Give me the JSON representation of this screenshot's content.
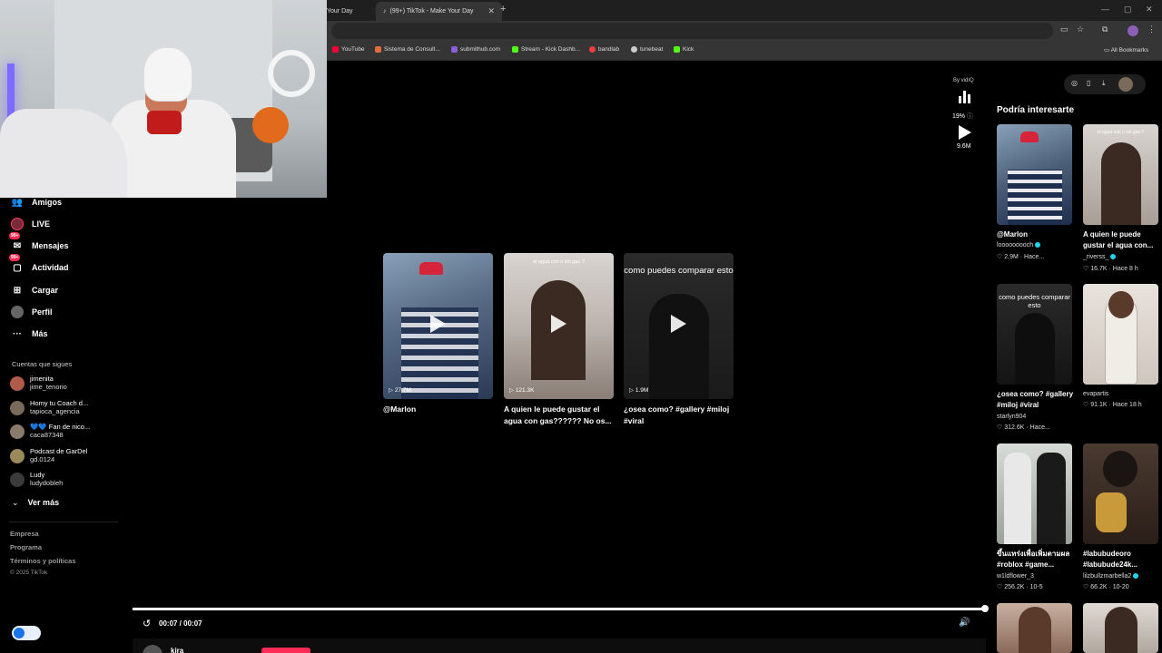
{
  "browser": {
    "tabs": [
      {
        "title": "Your Day"
      },
      {
        "title": "(99+) TikTok - Make Your Day"
      }
    ],
    "bookmarks": [
      "YouTube",
      "Sistema de Consult...",
      "submithub.com",
      "Stream - Kick Dashb...",
      "bandlab",
      "tunebeat",
      "Kick"
    ],
    "all_bookmarks": "All Bookmarks"
  },
  "sidebar": {
    "items": [
      {
        "label": "Amigos",
        "icon": "friends-icon"
      },
      {
        "label": "LIVE",
        "icon": "live-icon"
      },
      {
        "label": "Mensajes",
        "icon": "messages-icon",
        "badge": "99+"
      },
      {
        "label": "Actividad",
        "icon": "activity-icon",
        "badge": "99+"
      },
      {
        "label": "Cargar",
        "icon": "upload-icon"
      },
      {
        "label": "Perfil",
        "icon": "profile-icon"
      },
      {
        "label": "Más",
        "icon": "more-icon"
      }
    ],
    "following_title": "Cuentas que sigues",
    "following": [
      {
        "name": "jimenita",
        "handle": "jime_tenorio"
      },
      {
        "name": "Homy tu Coach d...",
        "handle": "tapioca_agencia"
      },
      {
        "name": "💙💙 Fan de nico...",
        "handle": "caca87348"
      },
      {
        "name": "Podcast de GarDel",
        "handle": "gd.0124"
      },
      {
        "name": "Ludy",
        "handle": "ludydobleh"
      }
    ],
    "see_more": "Ver más",
    "footer": [
      "Empresa",
      "Programa",
      "Términos y políticas"
    ],
    "copyright": "© 2025 TikTok"
  },
  "center": {
    "videos": [
      {
        "views": "27.7M",
        "caption": "@Marlon",
        "overlay": ""
      },
      {
        "views": "121.3K",
        "caption": "A quien le puede gustar el agua con gas?????? No os...",
        "overlay": "el agua con o sin gas ?"
      },
      {
        "views": "1.9M",
        "caption": "¿osea como? #gallery #miloj #viral",
        "overlay": "como puedes comparar esto"
      }
    ],
    "vidiq_label": "By vidIQ",
    "vidiq_percent": "19%",
    "play_views": "9.6M",
    "time": "00:07 / 00:07",
    "progress": 1.0,
    "bottom_user": "kira"
  },
  "right_panel": {
    "title": "Podría interesarte",
    "items": [
      {
        "caption": "@Marlon",
        "user": "looooooooch",
        "likes": "2.9M",
        "time": "Hace...",
        "overlay": ""
      },
      {
        "caption": "A quien le puede gustar el agua con...",
        "user": "_riverss_",
        "likes": "16.7K",
        "time": "Hace 8 h",
        "overlay": "el agua con o sin gas ?"
      },
      {
        "caption": "¿osea como? #gallery #miloj #viral",
        "user": "starlyn904",
        "likes": "312.6K",
        "time": "Hace...",
        "overlay": "como puedes comparar esto"
      },
      {
        "caption": "",
        "user": "evapartis",
        "likes": "91.1K",
        "time": "Hace 18 h",
        "overlay": ""
      },
      {
        "caption": "ขึ้นแทร่งเพื่อเพิ่มตามผล #roblox #game...",
        "user": "w1ldflower_3",
        "likes": "256.2K",
        "time": "10-5",
        "overlay": ""
      },
      {
        "caption": "#labubudeoro #labubude24k...",
        "user": "lilzbullzmarbella2",
        "likes": "66.2K",
        "time": "10-20",
        "overlay": ""
      }
    ]
  },
  "colors": {
    "accent": "#fe2c55",
    "background": "#000000",
    "verified": "#20d5ec"
  }
}
